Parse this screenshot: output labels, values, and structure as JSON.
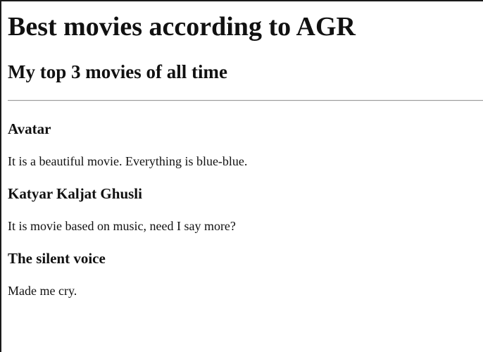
{
  "page": {
    "title": "Best movies according to AGR",
    "subtitle": "My top 3 movies of all time"
  },
  "movies": [
    {
      "title": "Avatar",
      "description": "It is a beautiful movie. Everything is blue-blue."
    },
    {
      "title": "Katyar Kaljat Ghusli",
      "description": "It is movie based on music, need I say more?"
    },
    {
      "title": "The silent voice",
      "description": "Made me cry."
    }
  ]
}
